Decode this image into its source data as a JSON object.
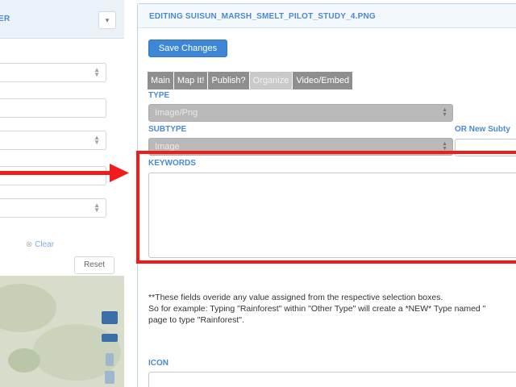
{
  "left_panel": {
    "header_text": "ER",
    "header_button_icon": "chevron-icon",
    "clear_link": "Clear",
    "reset_button": "Reset"
  },
  "editor": {
    "title": "EDITING SUISUN_MARSH_SMELT_PILOT_STUDY_4.PNG",
    "save_button": "Save Changes",
    "tabs": [
      {
        "label": "Main",
        "active": false
      },
      {
        "label": "Map It!",
        "active": false
      },
      {
        "label": "Publish?",
        "active": false
      },
      {
        "label": "Organize",
        "active": true
      },
      {
        "label": "Video/Embed",
        "active": false
      }
    ],
    "type_label": "TYPE",
    "type_value": "Image/Png",
    "subtype_label": "SUBTYPE",
    "subtype_value": "Image",
    "new_subtype_label": "OR New Subty",
    "keywords_label": "KEYWORDS",
    "keywords_value": "",
    "note_line1": "**These fields overide any value assigned from the respective selection boxes.",
    "note_line2": "So for example: Typing \"Rainforest\" within \"Other Type\" will create a *NEW* Type named \"",
    "note_line3": "page to type \"Rainforest\".",
    "icon_label": "ICON"
  },
  "annotation": {
    "arrow_color": "#f21b1b",
    "box_color": "#f21b1b"
  },
  "colors": {
    "accent": "#4a8ad0",
    "primary_button": "#3d87d6",
    "tab_bg": "#8e8e8e",
    "disabled_select": "#b9b9b9"
  }
}
